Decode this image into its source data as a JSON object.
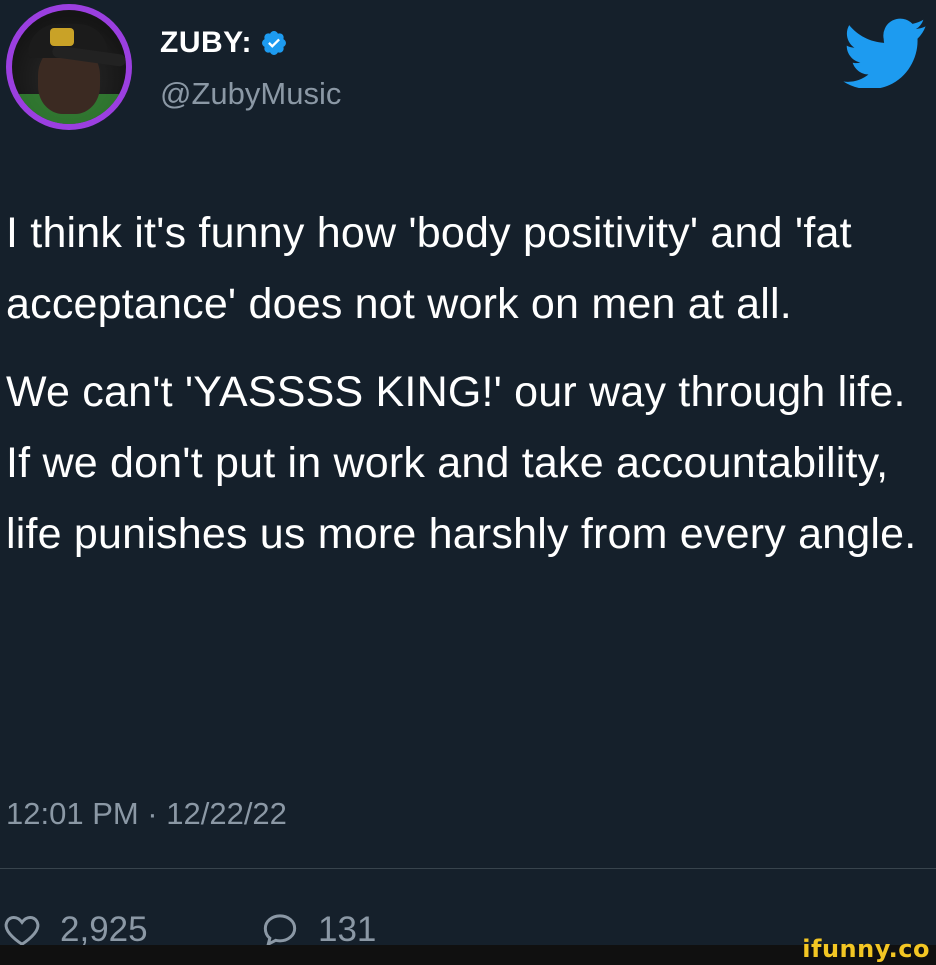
{
  "author": {
    "display_name": "ZUBY:",
    "handle": "@ZubyMusic",
    "verified": true
  },
  "tweet": {
    "paragraphs": [
      "I think it's funny how 'body positivity' and 'fat acceptance' does not work on men at all.",
      "We can't 'YASSSS KING!' our way through life. If we don't put in work and take accountability, life punishes us more harshly from every angle."
    ],
    "timestamp": "12:01 PM · 12/22/22"
  },
  "stats": {
    "likes": "2,925",
    "replies": "131"
  },
  "watermark": "ifunny.co",
  "colors": {
    "background": "#15202b",
    "text": "#ffffff",
    "secondary_text": "#8b98a5",
    "twitter_blue": "#1d9bf0",
    "watermark": "#f3c623"
  },
  "icons": {
    "verified": "verified-badge-icon",
    "bird": "twitter-bird-icon",
    "like": "heart-icon",
    "reply": "comment-bubble-icon"
  }
}
